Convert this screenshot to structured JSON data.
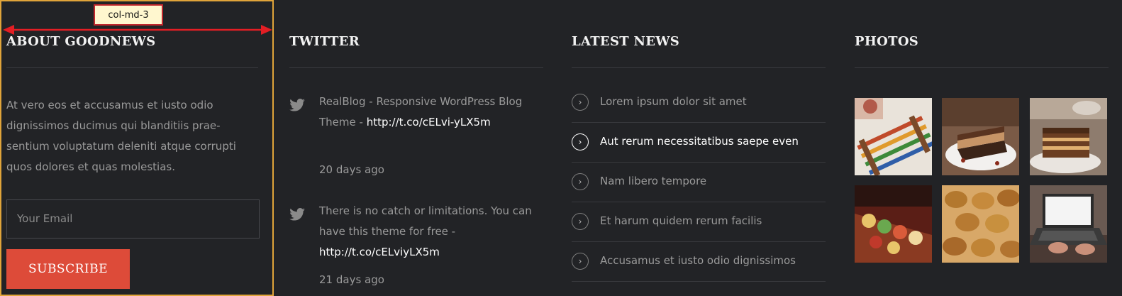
{
  "annotation": {
    "label": "col-md-3"
  },
  "about": {
    "heading": "ABOUT GOODNEWS",
    "text": "At vero eos et accusamus et iusto odio dignissimos ducimus qui blanditiis prae-sentium voluptatum deleniti atque corrupti quos dolores et quas molestias.",
    "email_placeholder": "Your Email",
    "subscribe_label": "SUBSCRIBE"
  },
  "twitter": {
    "heading": "TWITTER",
    "tweets": [
      {
        "text": "RealBlog - Responsive WordPress Blog Theme - ",
        "link": "http://t.co/cELvi-yLX5m",
        "date": "20 days ago"
      },
      {
        "text": "There is no catch or limitations. You can have this theme for free  - ",
        "link": "http://t.co/cELviyLX5m",
        "date": "21 days ago"
      }
    ]
  },
  "news": {
    "heading": "LATEST NEWS",
    "items": [
      "Lorem ipsum dolor sit amet",
      "Aut rerum necessitatibus saepe even",
      "Nam libero tempore",
      "Et harum quidem rerum facilis",
      "Accusamus et iusto odio dignissimos"
    ],
    "active_index": 1
  },
  "photos": {
    "heading": "PHOTOS",
    "items": [
      "photo-abacus-toy",
      "photo-cake-slice",
      "photo-layered-cake",
      "photo-canapes-platter",
      "photo-pastries",
      "photo-laptop-typing"
    ]
  },
  "colors": {
    "background": "#222326",
    "accent": "#dd4b39",
    "column_outline": "#e0a43a",
    "annotation_red": "#c1272d"
  }
}
